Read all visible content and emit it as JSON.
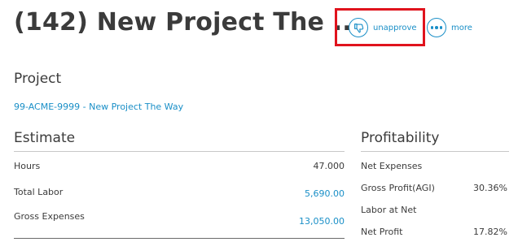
{
  "header": {
    "title": "(142) New Project The ...",
    "actions": {
      "unapprove_label": "unapprove",
      "more_label": "more"
    }
  },
  "project": {
    "heading": "Project",
    "link_text": "99-ACME-9999 - New Project The Way"
  },
  "estimate": {
    "heading": "Estimate",
    "rows": [
      {
        "label": "Hours",
        "value": "47.000"
      },
      {
        "label": "Total Labor",
        "value": "5,690.00"
      },
      {
        "label": "Gross Expenses",
        "value": "13,050.00"
      }
    ]
  },
  "profitability": {
    "heading": "Profitability",
    "rows": [
      {
        "label": "Net Expenses",
        "value": ""
      },
      {
        "label": "Gross Profit(AGI)",
        "value": "30.36%"
      },
      {
        "label": "Labor at Net",
        "value": ""
      },
      {
        "label": "Net Profit",
        "value": "17.82%"
      }
    ]
  },
  "colors": {
    "accent": "#1a8fc7",
    "highlight": "#e0131d",
    "text": "#3b3b3b"
  },
  "icons": {
    "unapprove": "thumbs-down-icon",
    "more": "ellipsis-icon"
  }
}
